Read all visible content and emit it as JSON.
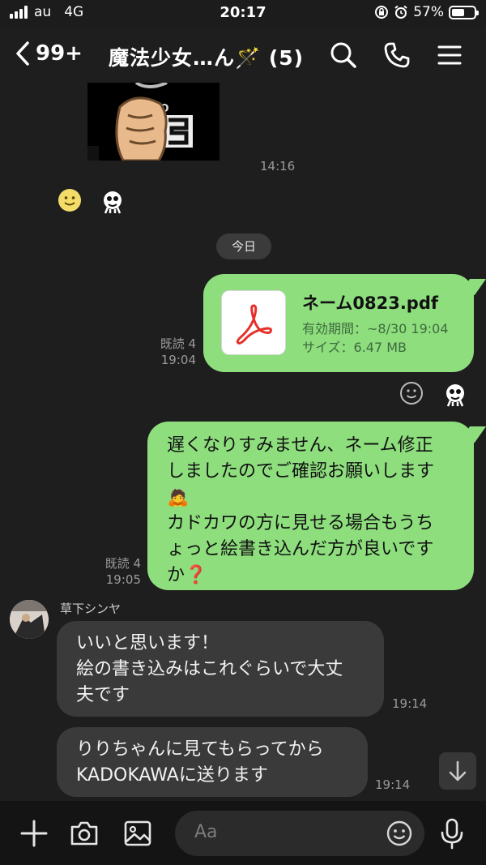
{
  "status_bar": {
    "carrier": "au",
    "network": "4G",
    "time": "20:17",
    "battery": "57%"
  },
  "header": {
    "back_count": "99+",
    "title": "魔法少女…ん🪄 (5)"
  },
  "chat": {
    "sticker_time": "14:16",
    "date_divider": "今日",
    "file_message": {
      "read_label": "既読 4",
      "time": "19:04",
      "file_name": "ネーム0823.pdf",
      "expiry": "有効期間：~8/30 19:04",
      "size": "サイズ：6.47 MB"
    },
    "text_message_out": {
      "read_label": "既読 4",
      "time": "19:05",
      "lines": [
        "遅くなりすみません、ネーム修正",
        "しましたのでご確認お願いします",
        "🙇",
        "カドカワの方に見せる場合もうち",
        "ょっと絵書き込んだ方が良いです",
        "か❓"
      ]
    },
    "incoming": {
      "sender_name": "草下シンヤ",
      "messages": [
        {
          "lines": [
            "いいと思います！",
            "絵の書き込みはこれぐらいで大丈",
            "夫です"
          ],
          "time": "19:14"
        },
        {
          "lines": [
            "りりちゃんに見てもらってから",
            "KADOKAWAに送ります"
          ],
          "time": "19:14"
        }
      ]
    }
  },
  "composer": {
    "placeholder": "Aa"
  },
  "icons": {
    "signal": "signal-icon",
    "rotation_lock": "rotation-lock-icon",
    "alarm": "alarm-icon",
    "back": "chevron-left-icon",
    "search": "search-icon",
    "call": "phone-icon",
    "menu": "menu-icon",
    "pdf": "pdf-icon",
    "add_reaction": "smiley-icon",
    "scroll_down": "arrow-down-icon",
    "plus": "plus-icon",
    "camera": "camera-icon",
    "image": "image-icon",
    "emoji": "emoji-icon",
    "mic": "microphone-icon"
  },
  "colors": {
    "outgoing_bubble": "#8ede7e",
    "incoming_bubble": "#3a3a3a",
    "background": "#1e1e1e",
    "pdf_red": "#e4322b"
  }
}
